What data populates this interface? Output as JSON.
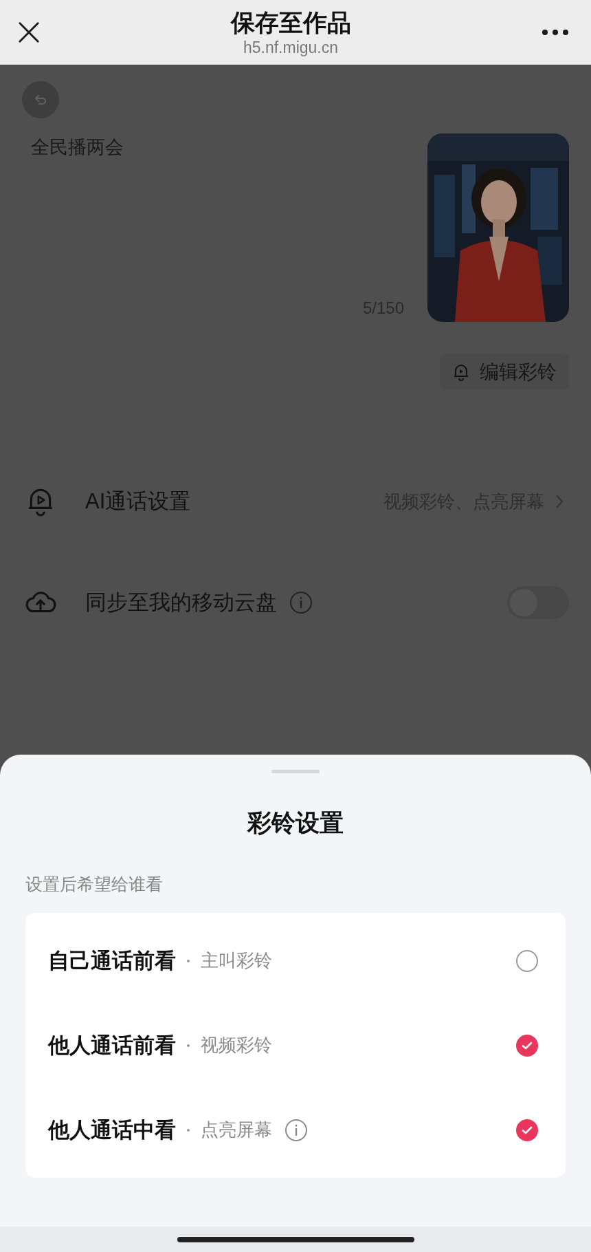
{
  "top_bar": {
    "title": "保存至作品",
    "url": "h5.nf.migu.cn"
  },
  "editor": {
    "text": "全民播两会",
    "count": "5/150",
    "edit_button": "编辑彩铃"
  },
  "settings": [
    {
      "kind": "link",
      "label": "AI通话设置",
      "value": "视频彩铃、点亮屏幕"
    },
    {
      "kind": "toggle",
      "label": "同步至我的移动云盘",
      "on": false
    }
  ],
  "sheet": {
    "title": "彩铃设置",
    "subtitle": "设置后希望给谁看",
    "options": [
      {
        "label": "自己通话前看",
        "detail": "主叫彩铃",
        "has_info": false,
        "checked": false
      },
      {
        "label": "他人通话前看",
        "detail": "视频彩铃",
        "has_info": false,
        "checked": true
      },
      {
        "label": "他人通话中看",
        "detail": "点亮屏幕",
        "has_info": true,
        "checked": true
      }
    ]
  }
}
